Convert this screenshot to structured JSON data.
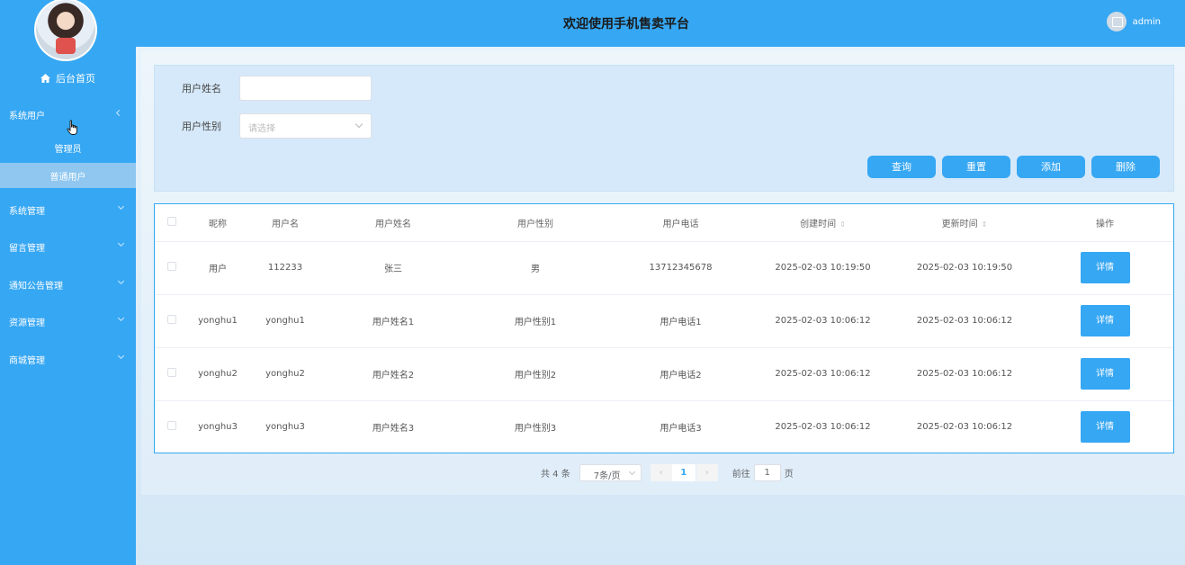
{
  "header": {
    "title": "欢迎使用手机售卖平台",
    "username": "admin"
  },
  "sidebar": {
    "home": "后台首页",
    "groups": [
      {
        "label": "系统用户",
        "expanded": true,
        "items": [
          "管理员",
          "普通用户"
        ],
        "active": "普通用户"
      },
      {
        "label": "系统管理"
      },
      {
        "label": "留言管理"
      },
      {
        "label": "通知公告管理"
      },
      {
        "label": "资源管理"
      },
      {
        "label": "商城管理"
      }
    ]
  },
  "search": {
    "name_label": "用户姓名",
    "name_value": "",
    "gender_label": "用户性别",
    "gender_placeholder": "请选择",
    "buttons": {
      "query": "查询",
      "reset": "重置",
      "add": "添加",
      "delete": "删除"
    }
  },
  "table": {
    "columns": [
      "昵称",
      "用户名",
      "用户姓名",
      "用户性别",
      "用户电话",
      "创建时间",
      "更新时间",
      "操作"
    ],
    "rows": [
      [
        "用户",
        "112233",
        "张三",
        "男",
        "13712345678",
        "2025-02-03 10:19:50",
        "2025-02-03 10:19:50"
      ],
      [
        "yonghu1",
        "yonghu1",
        "用户姓名1",
        "用户性别1",
        "用户电话1",
        "2025-02-03 10:06:12",
        "2025-02-03 10:06:12"
      ],
      [
        "yonghu2",
        "yonghu2",
        "用户姓名2",
        "用户性别2",
        "用户电话2",
        "2025-02-03 10:06:12",
        "2025-02-03 10:06:12"
      ],
      [
        "yonghu3",
        "yonghu3",
        "用户姓名3",
        "用户性别3",
        "用户电话3",
        "2025-02-03 10:06:12",
        "2025-02-03 10:06:12"
      ]
    ],
    "detail_label": "详情"
  },
  "pagination": {
    "total": "共 4 条",
    "page_size": "7条/页",
    "current_page": "1",
    "goto_label": "前往",
    "goto_value": "1",
    "page_unit": "页"
  },
  "colors": {
    "primary": "#36a7f3",
    "panel": "#d6e9fa"
  }
}
